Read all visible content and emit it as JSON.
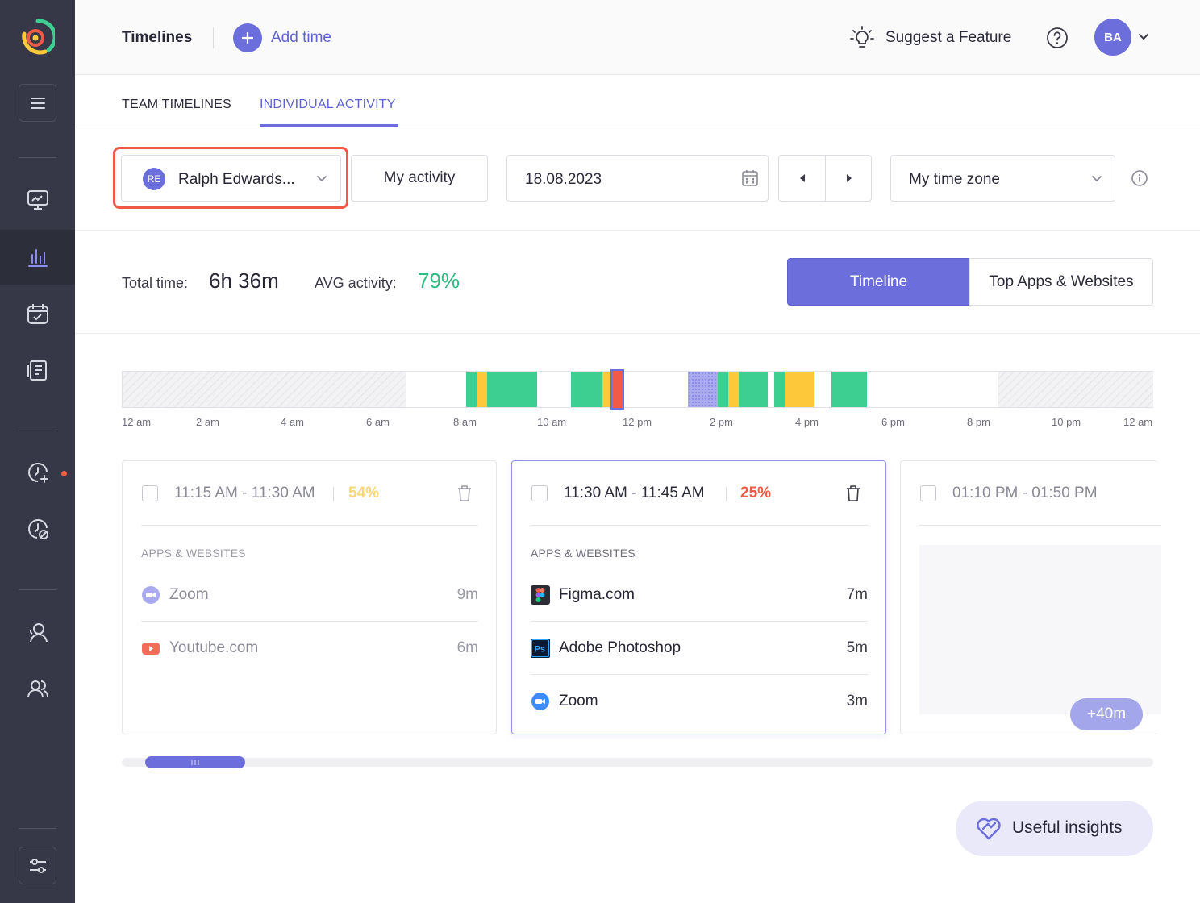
{
  "header": {
    "title": "Timelines",
    "add_time": "Add time",
    "suggest": "Suggest a Feature",
    "avatar_initials": "BA"
  },
  "tabs": {
    "team": "TEAM TIMELINES",
    "individual": "INDIVIDUAL ACTIVITY"
  },
  "filters": {
    "user_initials": "RE",
    "user_name": "Ralph Edwards...",
    "my_activity": "My activity",
    "date": "18.08.2023",
    "time_zone": "My time zone"
  },
  "summary": {
    "total_label": "Total time:",
    "total_value": "6h 36m",
    "avg_label": "AVG activity:",
    "avg_value": "79%",
    "view_timeline": "Timeline",
    "view_top_apps": "Top Apps & Websites"
  },
  "timeline_ticks": [
    "12 am",
    "2 am",
    "4 am",
    "6 am",
    "8 am",
    "10 am",
    "12 pm",
    "2 pm",
    "4 pm",
    "6 pm",
    "8 pm",
    "10 pm",
    "12 am"
  ],
  "colors": {
    "accent": "#6c6fdb",
    "high_activity": "#3ccf91",
    "mid_activity": "#fdc93a",
    "low_activity": "#f05a47",
    "manual": "#a9aaf0"
  },
  "cards": [
    {
      "range": "11:15 AM - 11:30 AM",
      "percent": "54%",
      "apps_label": "APPS & WEBSITES",
      "apps": [
        {
          "name": "Zoom",
          "time": "9m",
          "icon": "zoom-icon"
        },
        {
          "name": "Youtube.com",
          "time": "6m",
          "icon": "youtube-icon"
        }
      ]
    },
    {
      "range": "11:30 AM - 11:45 AM",
      "percent": "25%",
      "apps_label": "APPS & WEBSITES",
      "apps": [
        {
          "name": "Figma.com",
          "time": "7m",
          "icon": "figma-icon"
        },
        {
          "name": "Adobe Photoshop",
          "time": "5m",
          "icon": "photoshop-icon"
        },
        {
          "name": "Zoom",
          "time": "3m",
          "icon": "zoom-icon"
        }
      ]
    },
    {
      "range": "01:10 PM - 01:50 PM",
      "extra": "+40m"
    }
  ],
  "insights": "Useful insights"
}
